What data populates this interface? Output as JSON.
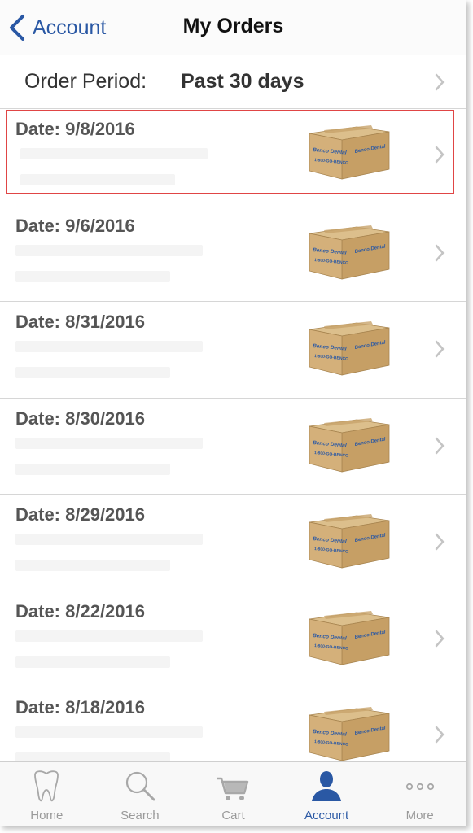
{
  "nav": {
    "back_label": "Account",
    "title": "My Orders"
  },
  "period": {
    "label": "Order Period:",
    "value": "Past 30 days"
  },
  "orders": [
    {
      "date": "Date: 9/8/2016"
    },
    {
      "date": "Date: 9/6/2016"
    },
    {
      "date": "Date: 8/31/2016"
    },
    {
      "date": "Date: 8/30/2016"
    },
    {
      "date": "Date: 8/29/2016"
    },
    {
      "date": "Date: 8/22/2016"
    },
    {
      "date": "Date: 8/18/2016"
    }
  ],
  "box_print": {
    "brand": "Benco Dental",
    "phone": "1-800-GO-BENCO"
  },
  "tabs": [
    {
      "label": "Home",
      "icon": "tooth-icon"
    },
    {
      "label": "Search",
      "icon": "search-icon"
    },
    {
      "label": "Cart",
      "icon": "cart-icon"
    },
    {
      "label": "Account",
      "icon": "person-icon"
    },
    {
      "label": "More",
      "icon": "more-dots-icon"
    }
  ],
  "colors": {
    "accent": "#2a58a4",
    "selection": "#e04545",
    "box": "#c9a36b"
  }
}
